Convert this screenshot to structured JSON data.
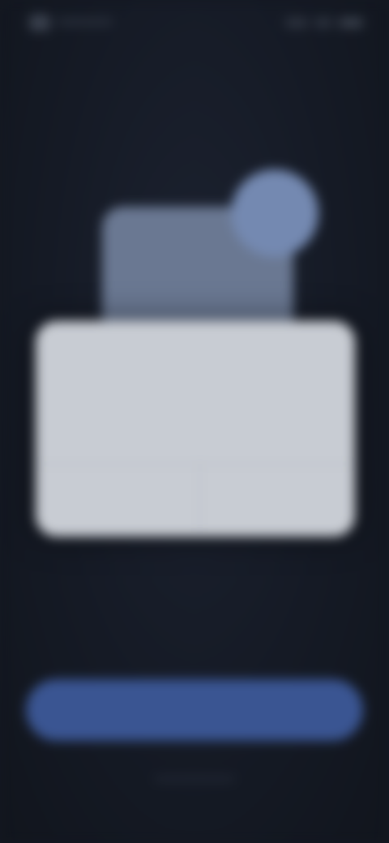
{
  "status_bar": {
    "time": "",
    "icons": [
      "signal-icon",
      "wifi-icon",
      "battery-icon"
    ]
  },
  "dialog": {
    "title": "",
    "message": "",
    "left_button_label": "",
    "right_button_label": ""
  },
  "primary_button": {
    "label": ""
  },
  "colors": {
    "background": "#141821",
    "dialog_surface": "#c8ccd3",
    "primary_accent": "#3a5592",
    "illustration_card": "#6a7892",
    "illustration_circle": "#7489b1"
  }
}
